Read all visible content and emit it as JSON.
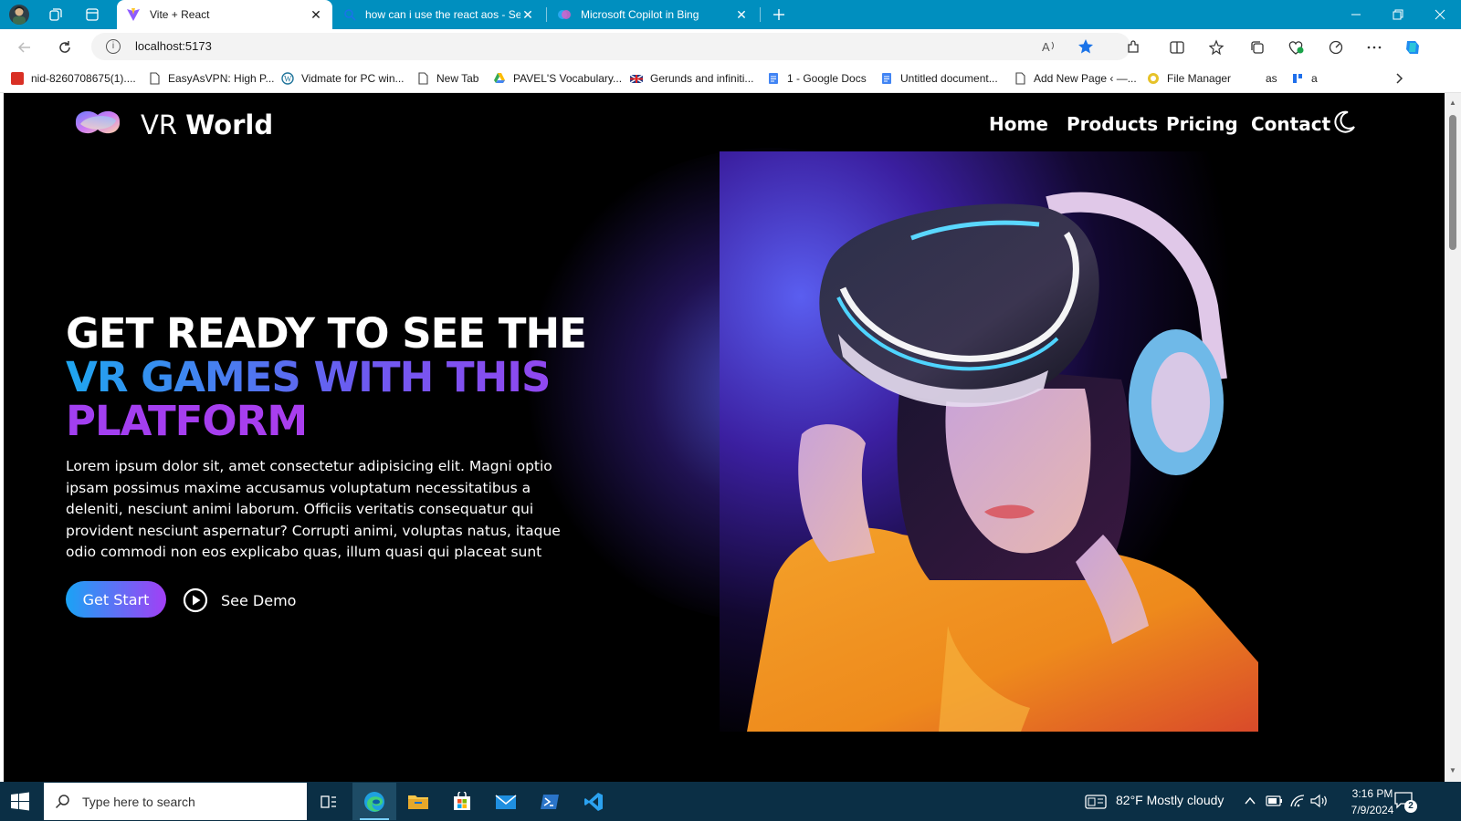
{
  "browser": {
    "tabs": [
      {
        "title": "Vite + React",
        "active": true
      },
      {
        "title": "how can i use the react aos - Sea",
        "active": false
      },
      {
        "title": "Microsoft Copilot in Bing",
        "active": false
      }
    ],
    "url": "localhost:5173",
    "bookmarks": [
      "nid-8260708675(1)....",
      "EasyAsVPN: High P...",
      "Vidmate for PC win...",
      "New Tab",
      "PAVEL'S Vocabulary...",
      "Gerunds and infiniti...",
      "1 - Google Docs",
      "Untitled document...",
      "Add New Page ‹ —...",
      "File Manager",
      "as",
      "a"
    ]
  },
  "site": {
    "brand_light": "VR",
    "brand_bold": "World",
    "nav": [
      "Home",
      "Products",
      "Pricing",
      "Contact"
    ],
    "hero": {
      "line1": "GET READY TO SEE THE",
      "line2": "VR GAMES WITH THIS",
      "line3": "PLATFORM",
      "body": "Lorem ipsum dolor sit, amet consectetur adipisicing elit. Magni optio ipsam possimus maxime accusamus voluptatum necessitatibus a deleniti, nesciunt animi laborum. Officiis veritatis consequatur qui provident nesciunt aspernatur? Corrupti animi, voluptas natus, itaque odio commodi non eos explicabo quas, illum quasi qui placeat sunt",
      "primary_button": "Get Start",
      "secondary_button": "See Demo"
    },
    "colors": {
      "gradient_start": "#1ea6f0",
      "gradient_mid": "#6a5cf0",
      "gradient_end": "#a13ff0",
      "background": "#000000"
    }
  },
  "taskbar": {
    "search_placeholder": "Type here to search",
    "weather": "82°F  Mostly cloudy",
    "time": "3:16 PM",
    "date": "7/9/2024",
    "notifications": "2"
  }
}
